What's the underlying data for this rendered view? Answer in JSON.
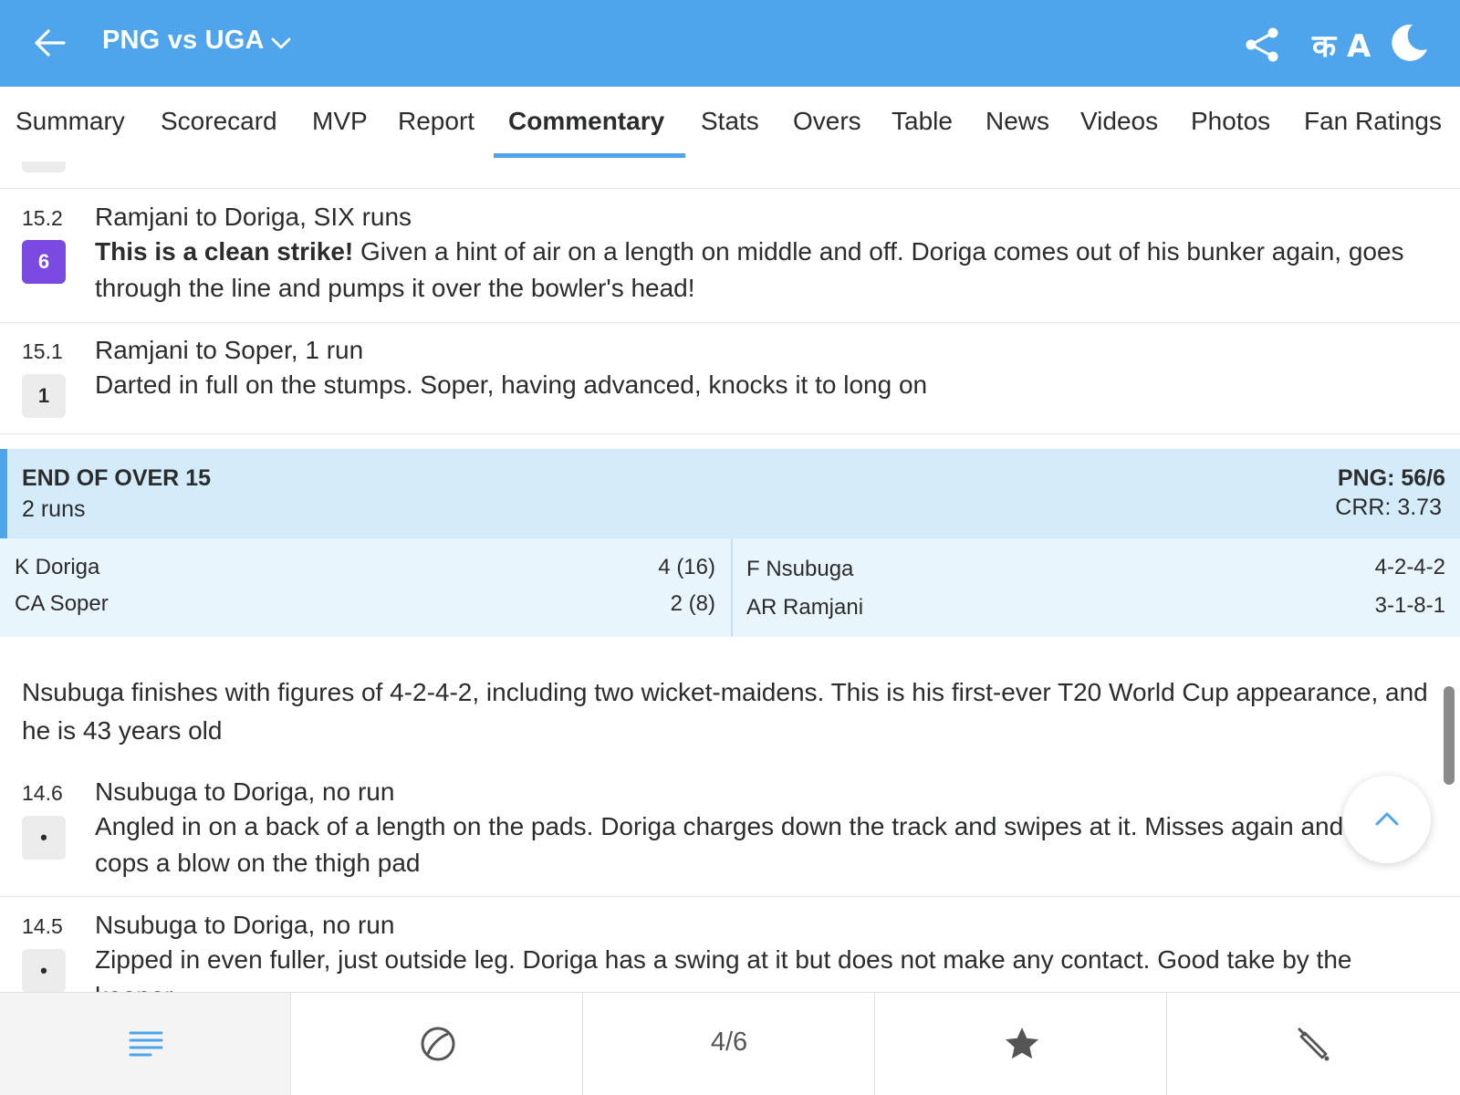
{
  "header": {
    "title": "PNG vs UGA",
    "lang_label": "क A"
  },
  "tabs": [
    "Summary",
    "Scorecard",
    "MVP",
    "Report",
    "Commentary",
    "Stats",
    "Overs",
    "Table",
    "News",
    "Videos",
    "Photos",
    "Fan Ratings"
  ],
  "active_tab": "Commentary",
  "commentary": [
    {
      "over": "15.2",
      "badge": "6",
      "title": "Ramjani to Doriga, SIX runs",
      "bold": "This is a clean strike!",
      "text": " Given a hint of air on a length on middle and off. Doriga comes out of his bunker again, goes through the line and pumps it over the bowler's head!"
    },
    {
      "over": "15.1",
      "badge": "1",
      "title": "Ramjani to Soper, 1 run",
      "text": "Darted in full on the stumps. Soper, having advanced, knocks it to long on"
    }
  ],
  "end_of_over": {
    "title": "END OF OVER 15",
    "runs": "2 runs",
    "score": "PNG: 56/6",
    "crr": "CRR: 3.73",
    "batters": [
      {
        "name": "K Doriga",
        "score": "4 (16)"
      },
      {
        "name": "CA Soper",
        "score": "2 (8)"
      }
    ],
    "bowlers": [
      {
        "name": "F Nsubuga",
        "figures": "4-2-4-2"
      },
      {
        "name": "AR Ramjani",
        "figures": "3-1-8-1"
      }
    ]
  },
  "note": "Nsubuga finishes with figures of 4-2-4-2, including two wicket-maidens. This is his first-ever T20 World Cup appearance, and he is 43 years old",
  "commentary2": [
    {
      "over": "14.6",
      "badge": "•",
      "title": "Nsubuga to Doriga, no run",
      "text": "Angled in on a back of a length on the pads. Doriga charges down the track and swipes at it. Misses again and cops a blow on the thigh pad"
    },
    {
      "over": "14.5",
      "badge": "•",
      "title": "Nsubuga to Doriga, no run",
      "text": "Zipped in even fuller, just outside leg. Doriga has a swing at it but does not make any contact. Good take by the keeper"
    }
  ],
  "bottom_bar": {
    "innings_label": "4/6",
    "icons": [
      "list-icon",
      "ball-icon",
      "innings-counter",
      "star-icon",
      "bat-icon"
    ]
  },
  "colors": {
    "header": "#4ea5eb",
    "six_badge": "#7b4ae0",
    "eoo_bg": "#d4ecfa",
    "players_bg": "#e8f5fc"
  }
}
